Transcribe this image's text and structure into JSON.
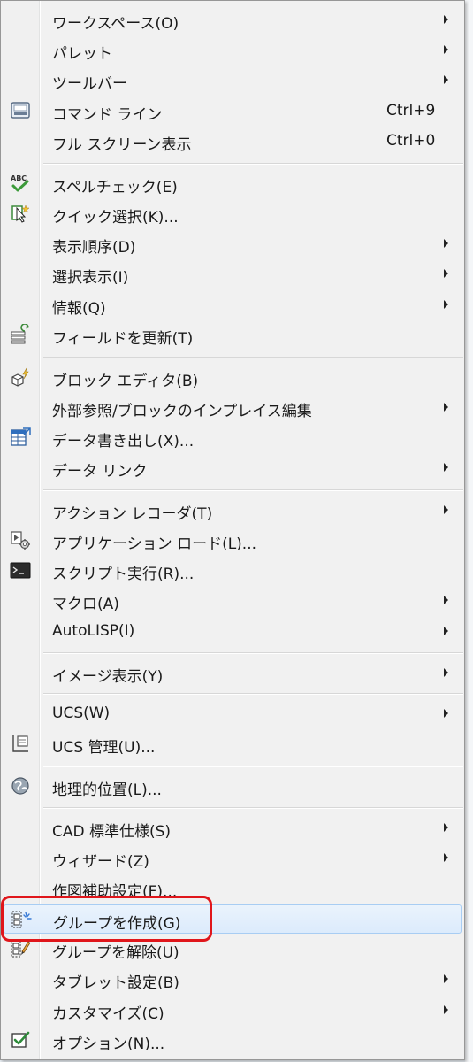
{
  "menu": {
    "items": [
      {
        "label": "ワークスペース(O)",
        "shortcut": "",
        "submenu": true,
        "icon": ""
      },
      {
        "label": "パレット",
        "shortcut": "",
        "submenu": true,
        "icon": ""
      },
      {
        "label": "ツールバー",
        "shortcut": "",
        "submenu": true,
        "icon": ""
      },
      {
        "label": "コマンド ライン",
        "shortcut": "Ctrl+9",
        "submenu": false,
        "icon": "command-line-icon"
      },
      {
        "label": "フル スクリーン表示",
        "shortcut": "Ctrl+0",
        "submenu": false,
        "icon": ""
      },
      {
        "label": "スペルチェック(E)",
        "shortcut": "",
        "submenu": false,
        "icon": "spell-check-icon"
      },
      {
        "label": "クイック選択(K)...",
        "shortcut": "",
        "submenu": false,
        "icon": "quick-select-icon"
      },
      {
        "label": "表示順序(D)",
        "shortcut": "",
        "submenu": true,
        "icon": ""
      },
      {
        "label": "選択表示(I)",
        "shortcut": "",
        "submenu": true,
        "icon": ""
      },
      {
        "label": "情報(Q)",
        "shortcut": "",
        "submenu": true,
        "icon": ""
      },
      {
        "label": "フィールドを更新(T)",
        "shortcut": "",
        "submenu": false,
        "icon": "update-field-icon"
      },
      {
        "label": "ブロック エディタ(B)",
        "shortcut": "",
        "submenu": false,
        "icon": "block-editor-icon"
      },
      {
        "label": "外部参照/ブロックのインプレイス編集",
        "shortcut": "",
        "submenu": true,
        "icon": ""
      },
      {
        "label": "データ書き出し(X)...",
        "shortcut": "",
        "submenu": false,
        "icon": "data-extraction-icon"
      },
      {
        "label": "データ リンク",
        "shortcut": "",
        "submenu": true,
        "icon": ""
      },
      {
        "label": "アクション レコーダ(T)",
        "shortcut": "",
        "submenu": true,
        "icon": ""
      },
      {
        "label": "アプリケーション ロード(L)...",
        "shortcut": "",
        "submenu": false,
        "icon": "load-application-icon"
      },
      {
        "label": "スクリプト実行(R)...",
        "shortcut": "",
        "submenu": false,
        "icon": "run-script-icon"
      },
      {
        "label": "マクロ(A)",
        "shortcut": "",
        "submenu": true,
        "icon": ""
      },
      {
        "label": "AutoLISP(I)",
        "shortcut": "",
        "submenu": true,
        "icon": ""
      },
      {
        "label": "イメージ表示(Y)",
        "shortcut": "",
        "submenu": true,
        "icon": ""
      },
      {
        "label": "UCS(W)",
        "shortcut": "",
        "submenu": true,
        "icon": ""
      },
      {
        "label": "UCS 管理(U)...",
        "shortcut": "",
        "submenu": false,
        "icon": "ucs-manager-icon"
      },
      {
        "label": "地理的位置(L)...",
        "shortcut": "",
        "submenu": false,
        "icon": "geographic-location-icon"
      },
      {
        "label": "CAD 標準仕様(S)",
        "shortcut": "",
        "submenu": true,
        "icon": ""
      },
      {
        "label": "ウィザード(Z)",
        "shortcut": "",
        "submenu": true,
        "icon": ""
      },
      {
        "label": "作図補助設定(F)...",
        "shortcut": "",
        "submenu": false,
        "icon": ""
      },
      {
        "label": "グループを作成(G)",
        "shortcut": "",
        "submenu": false,
        "icon": "create-group-icon",
        "highlighted": true
      },
      {
        "label": "グループを解除(U)",
        "shortcut": "",
        "submenu": false,
        "icon": "ungroup-icon"
      },
      {
        "label": "タブレット設定(B)",
        "shortcut": "",
        "submenu": true,
        "icon": ""
      },
      {
        "label": "カスタマイズ(C)",
        "shortcut": "",
        "submenu": true,
        "icon": ""
      },
      {
        "label": "オプション(N)...",
        "shortcut": "",
        "submenu": false,
        "icon": "options-icon"
      }
    ]
  },
  "colors": {
    "highlight_border": "#a8cdf3",
    "callout_red": "#e0161b",
    "menu_background": "#f1f1f1"
  }
}
